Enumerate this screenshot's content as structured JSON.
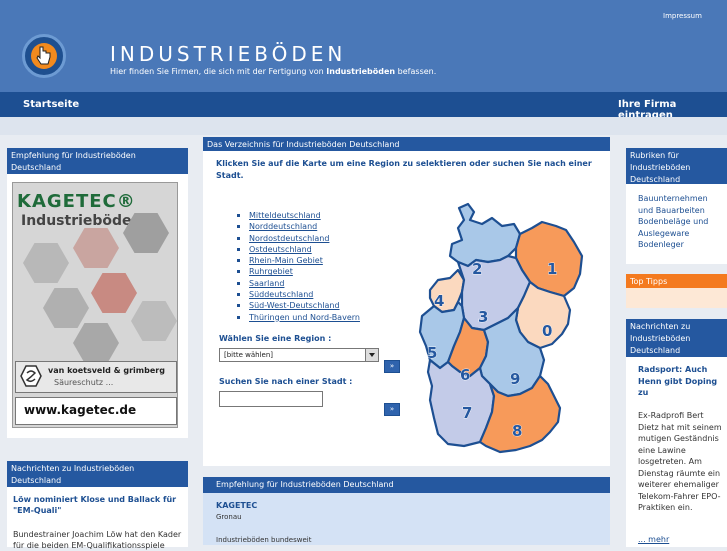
{
  "header": {
    "title": "INDUSTRIEBÖDEN",
    "subtitle_pre": "Hier finden Sie Firmen, die sich mit der Fertigung von ",
    "subtitle_bold": "Industrieböden",
    "subtitle_post": " befassen.",
    "impressum": "Impressum"
  },
  "nav": {
    "home": "Startseite",
    "own_firm": "Ihre Firma eintragen"
  },
  "left": {
    "box1_title": "Empfehlung für Industrieböden Deutschland",
    "ad": {
      "brand": "KAGETEC®",
      "product": "Industrieböden",
      "company": "van koetsveld & grimberg",
      "company_sub": "Säureschutz ...",
      "url": "www.kagetec.de"
    },
    "box2_title": "Nachrichten zu Industrieböden Deutschland",
    "news_title": "Löw nominiert Klose und Ballack für \"EM-Quali\"",
    "news_text": "Bundestrainer Joachim Löw hat den Kader für die beiden EM-Qualifikationsspiele"
  },
  "center": {
    "header": "Das Verzeichnis für Industrieböden Deutschland",
    "intro": "Klicken Sie auf die Karte um eine Region zu selektieren oder suchen Sie nach einer Stadt.",
    "regions": [
      "Mitteldeutschland",
      "Norddeutschland",
      "Nordostdeutschland",
      "Ostdeutschland",
      "Rhein-Main Gebiet",
      "Ruhrgebiet",
      "Saarland",
      "Süddeutschland",
      "Süd-West-Deutschland",
      "Thüringen und Nord-Bavern"
    ],
    "region_label": "Wählen Sie eine Region :",
    "region_select": "[bitte wählen]",
    "city_label": "Suchen Sie nach einer Stadt :",
    "go": "»",
    "map_numbers": [
      "0",
      "1",
      "2",
      "3",
      "4",
      "5",
      "6",
      "7",
      "8",
      "9"
    ],
    "box2_header": "Empfehlung für    Industrieböden    Deutschland",
    "firm_name": "KAGETEC",
    "firm_city": "Gronau",
    "firm_desc": "Industrieböden bundesweit"
  },
  "right": {
    "box1_title": "Rubriken für Industrieböden Deutschland",
    "box1_text": "Bauunternehmen und Bauarbeiten Bodenbeläge und Auslegeware Bodenleger",
    "box2_title": "Top Tipps",
    "box3_title": "Nachrichten zu Industrieböden Deutschland",
    "news_title": "Radsport: Auch Henn gibt Doping zu",
    "news_text": "Ex-Radprofi Bert Dietz hat mit seinem mutigen Geständnis eine Lawine losgetreten. Am Dienstag räumte ein weiterer ehemaliger Telekom-Fahrer EPO-Praktiken ein.",
    "more": "... mehr"
  },
  "colors": {
    "header_blue": "#4a78b8",
    "nav_blue": "#1d4f92",
    "orange": "#f47a1f",
    "map_orange": "#f79a5a",
    "map_lightblue": "#a9c8e8",
    "map_lavender": "#c3cbe8",
    "map_peach": "#fbd9bf"
  }
}
